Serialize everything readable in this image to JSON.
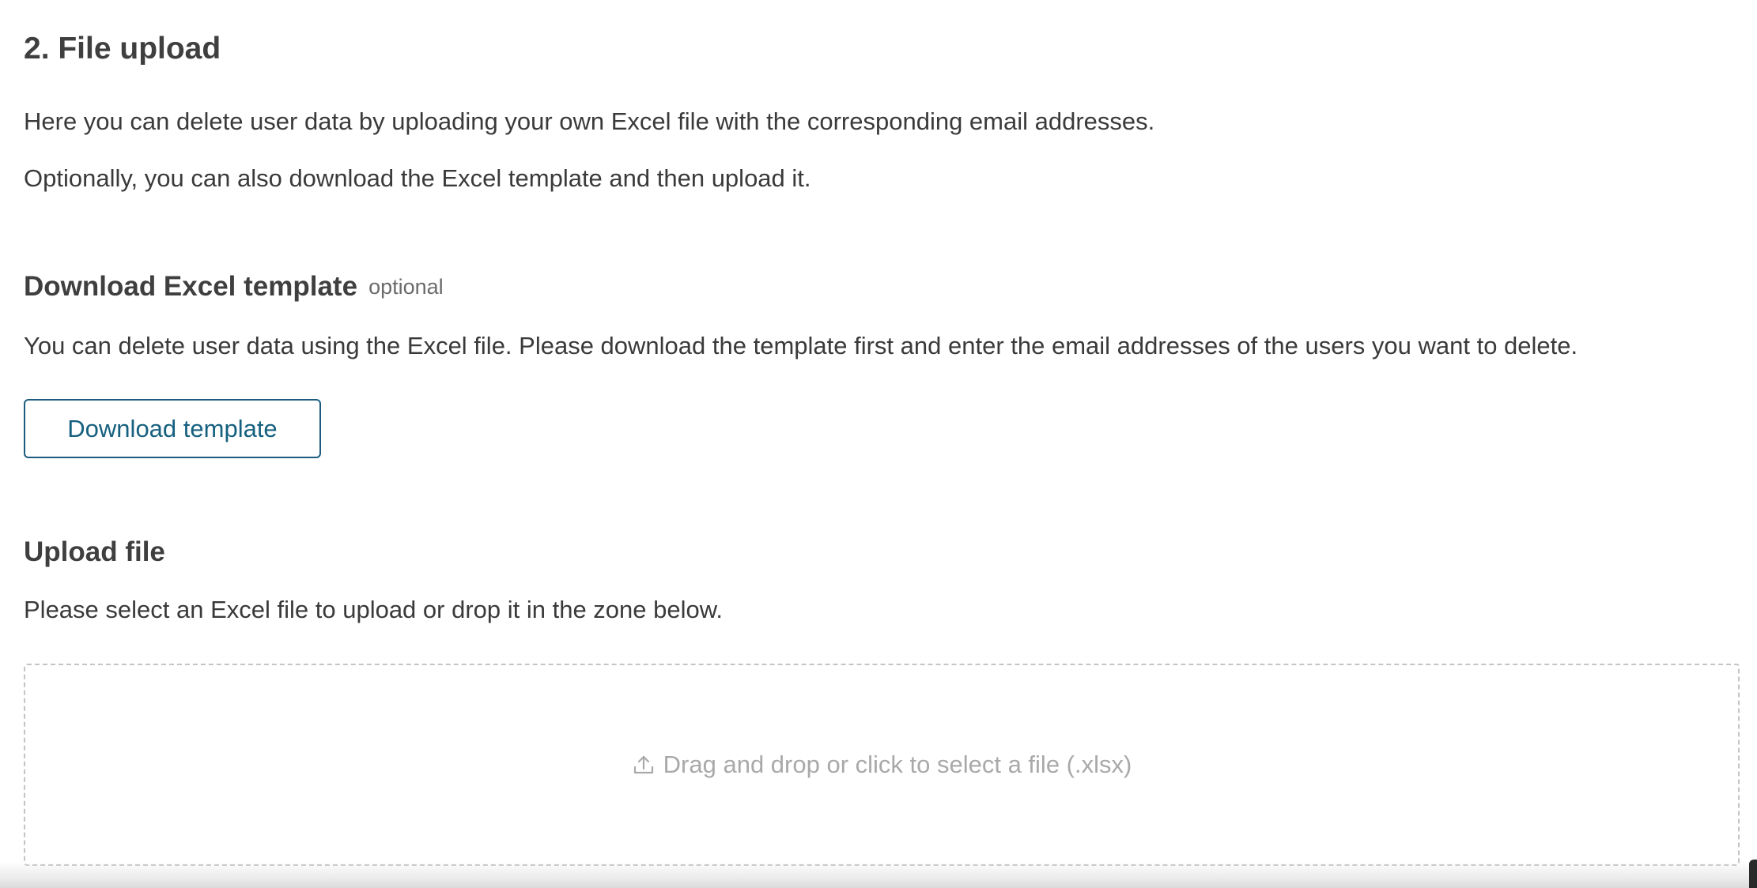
{
  "section": {
    "title": "2. File upload",
    "intro_line_1": "Here you can delete user data by uploading your own Excel file with the corresponding email addresses.",
    "intro_line_2": "Optionally, you can also download the Excel template and then upload it."
  },
  "download_template": {
    "heading": "Download Excel template",
    "optional_tag": "optional",
    "description": "You can delete user data using the Excel file. Please download the template first and enter the email addresses of the users you want to delete.",
    "button_label": "Download template"
  },
  "upload_file": {
    "heading": "Upload file",
    "description": "Please select an Excel file to upload or drop it in the zone below.",
    "dropzone_label": "Drag and drop or click to select a file (.xlsx)",
    "dropzone_icon": "upload-icon"
  },
  "colors": {
    "text": "#3a3a3a",
    "button_border": "#1d5c80",
    "button_text": "#16607f",
    "dropzone_border": "#c4c4c4",
    "dropzone_text": "#a9a9a9"
  }
}
